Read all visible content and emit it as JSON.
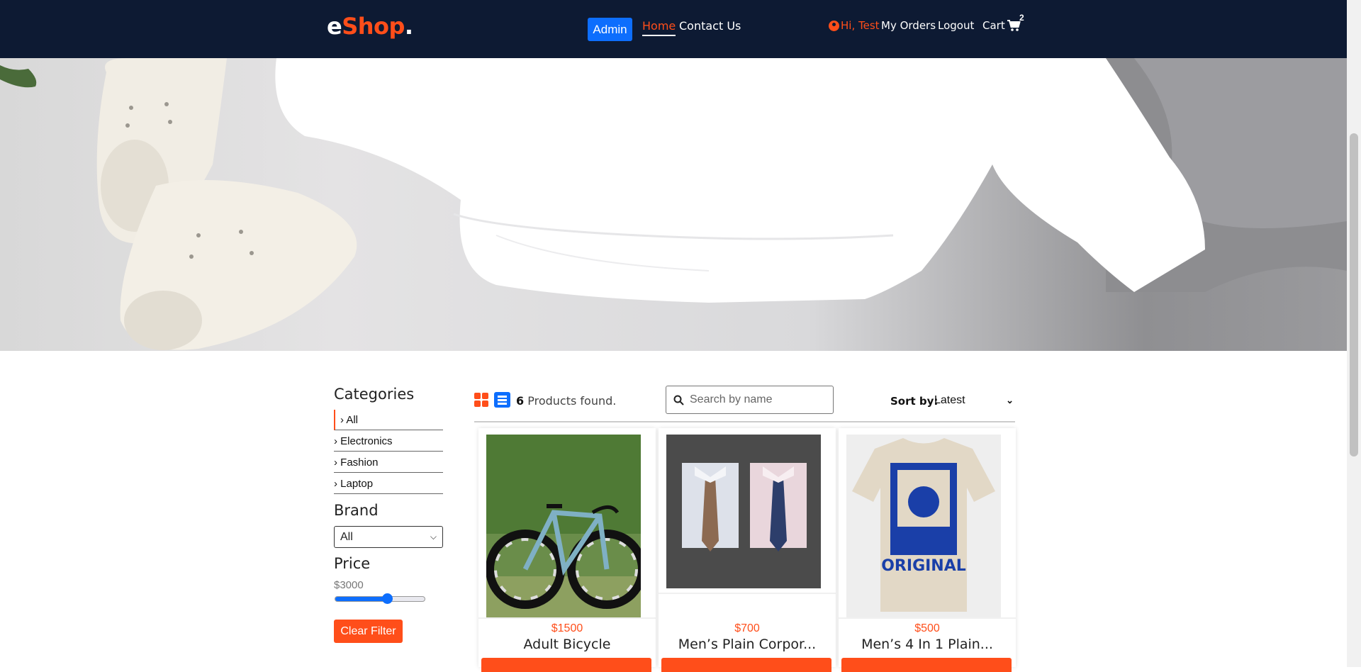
{
  "header": {
    "logo_e": "e",
    "logo_shop": "Shop",
    "logo_dot": ".",
    "admin_label": "Admin",
    "home_label": "Home",
    "contact_label": "Contact Us",
    "greeting": "Hi, Test",
    "orders_label": "My Orders",
    "logout_label": "Logout",
    "cart_label": "Cart",
    "cart_count": "2"
  },
  "sidebar": {
    "categories_title": "Categories",
    "categories": [
      "› All",
      "› Electronics",
      "› Fashion",
      "› Laptop"
    ],
    "brand_title": "Brand",
    "brand_selected": "All",
    "price_title": "Price",
    "price_value": "$3000",
    "price_slider_fraction": 0.58,
    "clear_label": "Clear Filter"
  },
  "toolbar": {
    "count": "6",
    "found_text": " Products found.",
    "search_placeholder": "Search by name",
    "sort_label": "Sort by:",
    "sort_selected": "Latest"
  },
  "products": [
    {
      "price": "$1500",
      "name": "Adult Bicycle"
    },
    {
      "price": "$700",
      "name": "Men’s Plain Corpor..."
    },
    {
      "price": "$500",
      "name": "Men’s 4 In 1 Plain..."
    }
  ],
  "colors": {
    "accent": "#ff4e1a",
    "nav_bg": "#0d1a33",
    "primary": "#0d6efd"
  }
}
